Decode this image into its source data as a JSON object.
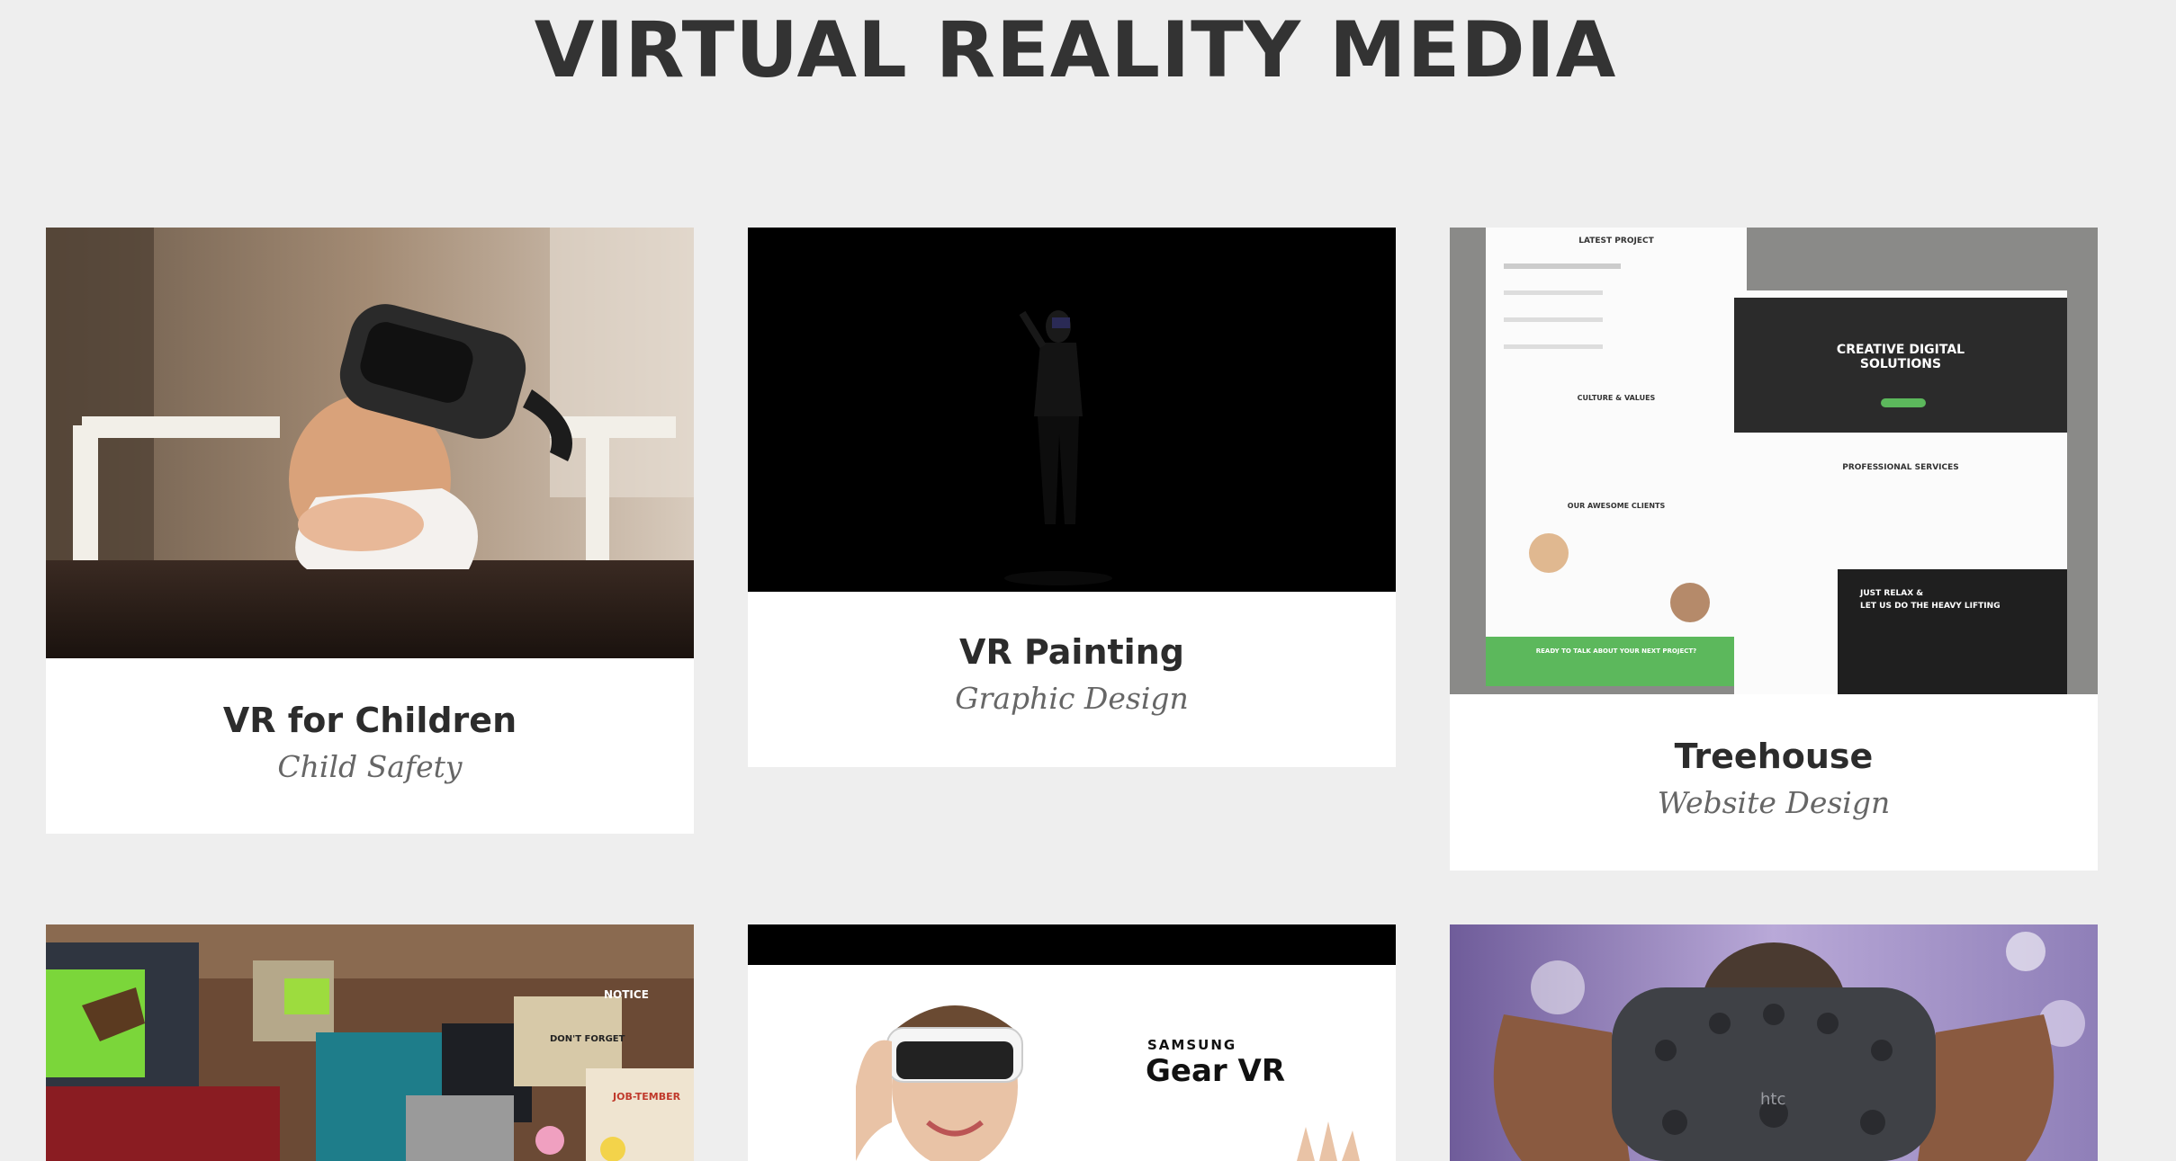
{
  "page": {
    "title": "VIRTUAL REALITY MEDIA"
  },
  "portfolio": [
    {
      "title": "VR for Children",
      "category": "Child Safety"
    },
    {
      "title": "VR Painting",
      "category": "Graphic Design"
    },
    {
      "title": "Treehouse",
      "category": "Website Design"
    },
    {
      "title": "",
      "category": ""
    },
    {
      "title": "",
      "category": ""
    },
    {
      "title": "",
      "category": ""
    }
  ],
  "mockup": {
    "latest_project": "LATEST PROJECT",
    "culture": "CULTURE & VALUES",
    "clients": "OUR AWESOME CLIENTS",
    "cta": "READY TO TALK ABOUT YOUR NEXT PROJECT?",
    "hero": "CREATIVE DIGITAL SOLUTIONS",
    "services": "PROFESSIONAL SERVICES",
    "relax_1": "JUST RELAX &",
    "relax_2": "LET US DO THE HEAVY LIFTING"
  },
  "gear_vr": {
    "brand": "SAMSUNG",
    "product": "Gear VR"
  },
  "game": {
    "notice": "NOTICE",
    "dont_forget": "DON'T FORGET",
    "calendar": "JOB-TEMBER"
  },
  "htc": {
    "logo": "htc"
  },
  "colors": {
    "background": "#eeeeee",
    "card": "#ffffff",
    "accent_green": "#5cb85c"
  }
}
